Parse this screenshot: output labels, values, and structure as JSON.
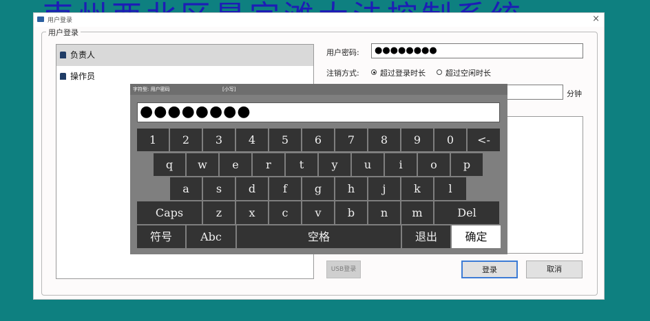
{
  "background_title": "南州西北区是宗滩大法控制系统",
  "dialog": {
    "title": "用户登录",
    "close_glyph": "×",
    "group_label": "用户登录",
    "users": [
      {
        "label": "负责人",
        "selected": true
      },
      {
        "label": "操作员",
        "selected": false
      }
    ],
    "password_label": "用户密码:",
    "password_value": "●●●●●●●●",
    "logout_label": "注销方式:",
    "logout_options": [
      {
        "label": "超过登录时长",
        "checked": true
      },
      {
        "label": "超过空闲时长",
        "checked": false
      }
    ],
    "minutes_unit": "分钟",
    "usb_button": "USB登录",
    "login_button": "登录",
    "cancel_button": "取消"
  },
  "keyboard": {
    "type_label": "字符型: 用户密码",
    "case_label": "[小写]",
    "display_value": "●●●●●●●●",
    "rows": [
      [
        "1",
        "2",
        "3",
        "4",
        "5",
        "6",
        "7",
        "8",
        "9",
        "0",
        "<-"
      ],
      [
        "q",
        "w",
        "e",
        "r",
        "t",
        "y",
        "u",
        "i",
        "o",
        "p"
      ],
      [
        "a",
        "s",
        "d",
        "f",
        "g",
        "h",
        "j",
        "k",
        "l"
      ],
      [
        "Caps",
        "z",
        "x",
        "c",
        "v",
        "b",
        "n",
        "m",
        "Del"
      ],
      [
        "符号",
        "Abc",
        "空格",
        "退出",
        "确定"
      ]
    ]
  },
  "colors": {
    "desktop_bg": "#0e8080",
    "background_title": "#1d1db6",
    "key_bg": "#333333",
    "keyboard_bg": "#7f7f7f",
    "login_button_border": "#3b7bd5"
  }
}
